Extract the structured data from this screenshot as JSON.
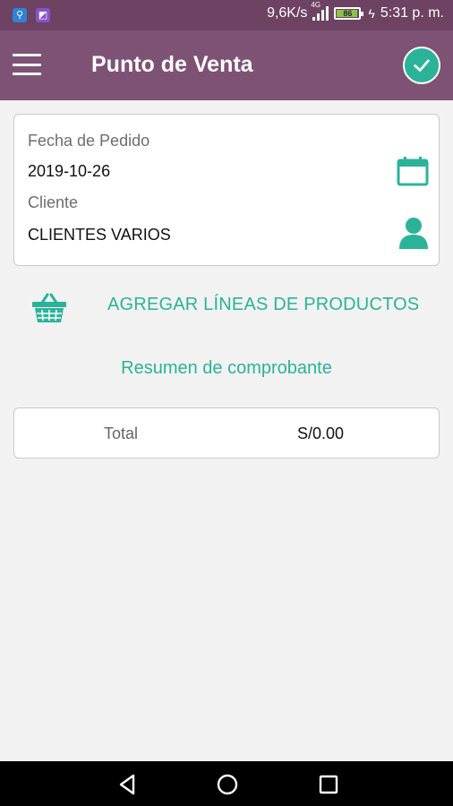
{
  "status_bar": {
    "speed": "9,6K/s",
    "network": "4G",
    "battery": "86",
    "battery_level": 0.86,
    "time": "5:31 p. m."
  },
  "app_bar": {
    "title": "Punto de Venta",
    "menu_icon": "hamburger-icon",
    "confirm_icon": "check-circle-icon"
  },
  "order": {
    "date_label": "Fecha de Pedido",
    "date_value": "2019-10-26",
    "client_label": "Cliente",
    "client_value": "CLIENTES VARIOS",
    "date_icon": "calendar-icon",
    "client_icon": "person-icon"
  },
  "actions": {
    "add_lines_label": "AGREGAR LÍNEAS DE PRODUCTOS",
    "add_icon": "basket-icon"
  },
  "summary": {
    "title": "Resumen de comprobante",
    "total_label": "Total",
    "total_value": "S/0.00"
  },
  "colors": {
    "status_bar": "#6d4262",
    "app_bar": "#7e5275",
    "accent": "#2bb39a",
    "background": "#f2f2f2"
  }
}
